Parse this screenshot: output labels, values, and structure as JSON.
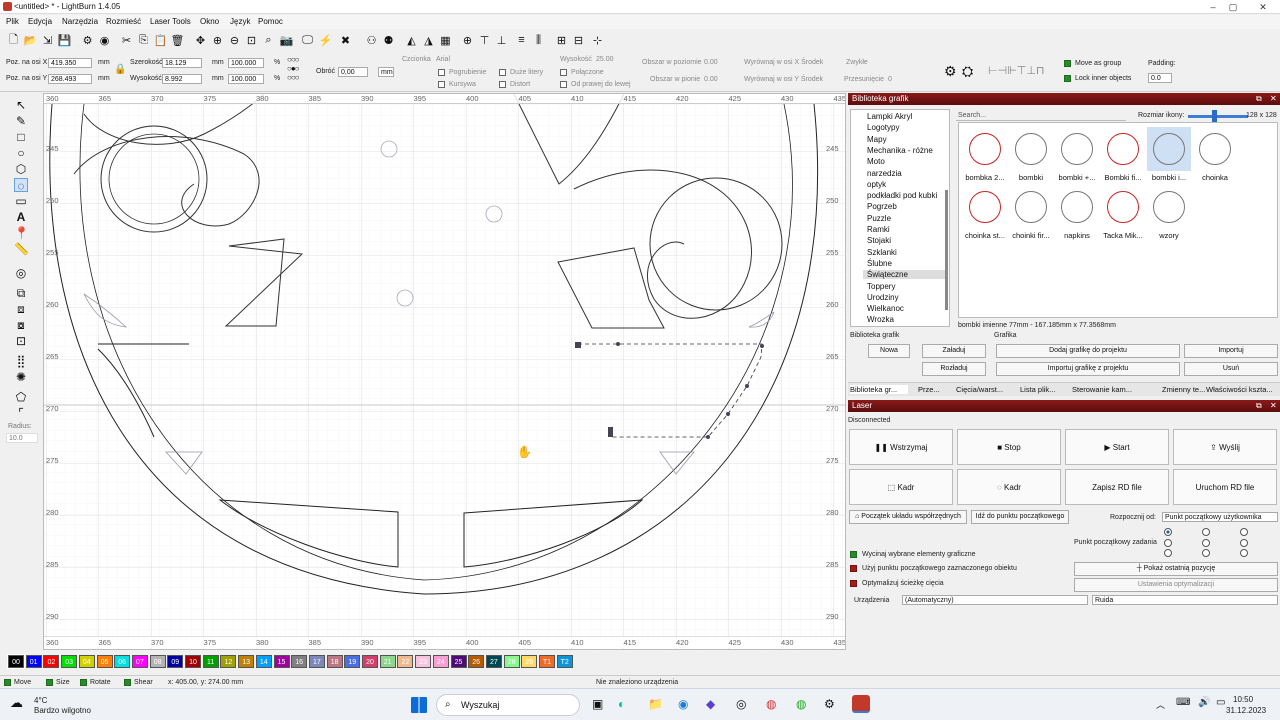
{
  "window": {
    "title": "<untitled> * - LightBurn 1.4.05"
  },
  "menu": [
    "Plik",
    "Edycja",
    "Narzędzia",
    "Rozmieść",
    "Laser Tools",
    "Okno",
    "Język",
    "Pomoc"
  ],
  "props": {
    "pos_x_label": "Poz. na osi X",
    "pos_x_value": "419.350",
    "pos_y_label": "Poz. na osi Y",
    "pos_y_value": "268.493",
    "unit_mm": "mm",
    "width_label": "Szerokość",
    "width_value": "18.129",
    "height_label": "Wysokość",
    "height_value": "8.992",
    "scale_x": "100.000",
    "scale_y": "100.000",
    "pct": "%",
    "rotate_label": "Obróć",
    "rotate_value": "0,00"
  },
  "text_opts": {
    "font_label": "Czcionka",
    "font_value": "Arial",
    "height_label": "Wysokość",
    "height_value": "25.00",
    "bold": "Pogrubienie",
    "upper": "Duże litery",
    "welded": "Połączone",
    "italic": "Kursywa",
    "distort": "Distort",
    "rtl": "Od prawej do lewej",
    "hspace_label": "Obszar w poziomie",
    "hspace_value": "0.00",
    "vspace_label": "Obszar w pionie",
    "vspace_value": "0.00",
    "alignx": "Wyrównaj w osi X Środek",
    "aligny": "Wyrównaj w osi Y Środek",
    "mode": "Zwykłe",
    "offset_label": "Przesunięcie",
    "offset_value": "0",
    "move_group": "Move as group",
    "lock_inner": "Lock inner objects",
    "padding_label": "Padding:",
    "padding_value": "0.0"
  },
  "radius": {
    "label": "Radius:",
    "value": "10.0"
  },
  "ruler": {
    "top": [
      "360",
      "365",
      "370",
      "375",
      "380",
      "385",
      "390",
      "395",
      "400",
      "405",
      "410",
      "415",
      "420",
      "425",
      "430",
      "435"
    ],
    "bottom": [
      "360",
      "365",
      "370",
      "375",
      "380",
      "385",
      "390",
      "395",
      "400",
      "405",
      "410",
      "415",
      "420",
      "425",
      "430",
      "435"
    ],
    "left": [
      "245",
      "250",
      "255",
      "260",
      "265",
      "270",
      "275",
      "280",
      "285",
      "290"
    ],
    "right": [
      "245",
      "250",
      "255",
      "260",
      "265",
      "270",
      "275",
      "280",
      "285",
      "290"
    ]
  },
  "palette": [
    {
      "label": "00",
      "color": "#000000"
    },
    {
      "label": "01",
      "color": "#0000ff"
    },
    {
      "label": "02",
      "color": "#ff0000"
    },
    {
      "label": "03",
      "color": "#00e000"
    },
    {
      "label": "04",
      "color": "#d0d000"
    },
    {
      "label": "05",
      "color": "#ff8000"
    },
    {
      "label": "06",
      "color": "#00e0e0"
    },
    {
      "label": "07",
      "color": "#ff00ff"
    },
    {
      "label": "08",
      "color": "#b4b4b4"
    },
    {
      "label": "09",
      "color": "#0000a0"
    },
    {
      "label": "10",
      "color": "#a00000"
    },
    {
      "label": "11",
      "color": "#00a000"
    },
    {
      "label": "12",
      "color": "#a0a000"
    },
    {
      "label": "13",
      "color": "#c08000"
    },
    {
      "label": "14",
      "color": "#00a0ff"
    },
    {
      "label": "15",
      "color": "#a000a0"
    },
    {
      "label": "16",
      "color": "#808080"
    },
    {
      "label": "17",
      "color": "#7d87b9"
    },
    {
      "label": "18",
      "color": "#bb7784"
    },
    {
      "label": "19",
      "color": "#4a6fe3"
    },
    {
      "label": "20",
      "color": "#d33f6a"
    },
    {
      "label": "21",
      "color": "#8cd78c"
    },
    {
      "label": "22",
      "color": "#f0b98d"
    },
    {
      "label": "23",
      "color": "#f6c4e1"
    },
    {
      "label": "24",
      "color": "#fa9ed4"
    },
    {
      "label": "25",
      "color": "#500a78"
    },
    {
      "label": "26",
      "color": "#b45a00"
    },
    {
      "label": "27",
      "color": "#004754"
    },
    {
      "label": "28",
      "color": "#86fa88"
    },
    {
      "label": "29",
      "color": "#ffdb66"
    },
    {
      "label": "T1",
      "color": "#f36926"
    },
    {
      "label": "T2",
      "color": "#0c96d9"
    }
  ],
  "status": {
    "move": "Move",
    "size": "Size",
    "rotate": "Rotate",
    "shear": "Shear",
    "coords": "x: 405.00, y: 274.00 mm",
    "device": "Nie znaleziono urządzenia"
  },
  "library": {
    "title": "Biblioteka grafik",
    "search_placeholder": "Search...",
    "icon_size_label": "Rozmiar ikony:",
    "icon_size_value": "128 x 128",
    "categories": [
      "Lampki Akryl",
      "Logotypy",
      "Mapy",
      "Mechanika - różne",
      "Moto",
      "narzedzia",
      "optyk",
      "podkładki pod kubki",
      "Pogrzeb",
      "Puzzle",
      "Ramki",
      "Stojaki",
      "Szklanki",
      "Ślubne",
      "Świąteczne",
      "Toppery",
      "Urodziny",
      "Wielkanoc",
      "Wrozka"
    ],
    "selected_category": "Świąteczne",
    "thumbs": [
      "bombka 2...",
      "bombki",
      "bombki +...",
      "Bombki fi...",
      "bombki i...",
      "choinka",
      "choinka st...",
      "choinki fir...",
      "napkins",
      "Tacka Mik...",
      "wzory"
    ],
    "selected_thumb": "bombki i...",
    "info": "bombki imienne 77mm - 167.185mm x 77.3568mm",
    "section_lib": "Biblioteka grafik",
    "section_graphic": "Grafika",
    "btn_new": "Nowa",
    "btn_load": "Załaduj",
    "btn_unload": "Rozładuj",
    "btn_add": "Dodaj grafikę do projektu",
    "btn_import_proj": "Importuj grafikę z projektu",
    "btn_import": "Importuj",
    "btn_delete": "Usuń",
    "tabs": [
      "Biblioteka gr...",
      "Prze...",
      "Cięcia/warst...",
      "Lista plik...",
      "Sterowanie kam...",
      "Zmienny te...",
      "Właściwości kszta..."
    ]
  },
  "laser": {
    "title": "Laser",
    "state": "Disconnected",
    "pause": "Wstrzymaj",
    "stop": "Stop",
    "start": "Start",
    "send": "Wyślij",
    "frame1": "Kadr",
    "frame2": "Kadr",
    "save_rd": "Zapisz RD file",
    "run_rd": "Uruchom RD file",
    "origin": "Początek układu współrzędnych",
    "goto_origin": "Idź do punktu początkowego",
    "start_from_label": "Rozpocznij od:",
    "start_from_value": "Punkt początkowy użytkownika",
    "job_origin_label": "Punkt początkowy zadania",
    "cut_selected": "Wycinaj wybrane elementy graficzne",
    "use_selection_origin": "Użyj punktu początkowego zaznaczonego obiektu",
    "optimize": "Optymalizuj ścieżkę cięcia",
    "show_last": "Pokaż ostatnią pozycję",
    "opt_settings": "Ustawienia optymalizacji",
    "devices_label": "Urządzenia",
    "devices_value": "(Automatyczny)",
    "device_name": "Ruida"
  },
  "taskbar": {
    "temp": "4°C",
    "weather": "Bardzo wilgotno",
    "search": "Wyszukaj",
    "time": "10:50",
    "date": "31.12.2023"
  }
}
